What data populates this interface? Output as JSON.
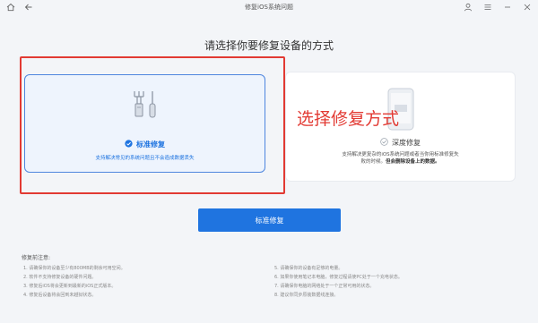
{
  "window": {
    "title": "修复iOS系统问题"
  },
  "heading": "请选择你要修复设备的方式",
  "cards": {
    "standard": {
      "title": "标准修复",
      "description": "支持解决常见的系统问题且不会造成数据丢失",
      "selected": true
    },
    "deep": {
      "title": "深度修复",
      "description_line1": "支持解决更复杂的iOS系统问题或者当你用标准修复失",
      "description_line2_prefix": "败的时候。",
      "description_line2_bold": "但会删除设备上的数据。",
      "selected": false
    }
  },
  "overlay_annotation": "选择修复方式",
  "primary_button": "标准修复",
  "notes": {
    "title": "修复前注意:",
    "left": [
      "1. 请确保你的设备至少有800MB的剩余可用空间。",
      "2. 软件不支持修复设备的硬件问题。",
      "3. 修复后iOS将会更新到最新的iOS正式版本。",
      "4. 修复后设备将会回到未越狱状态。"
    ],
    "right": [
      "5. 请确保你的设备有足够的电量。",
      "6. 如果你使用笔记本电脑，修复过程请使PC处于一个充电状态。",
      "7. 请确保你电脑的网络处于一个正常可用的状态。",
      "8. 建议你同步原装数据线连接。"
    ]
  },
  "colors": {
    "accent": "#1f74e0",
    "annotation_red": "#e23a33",
    "selected_card_bg": "#eef4fd"
  }
}
